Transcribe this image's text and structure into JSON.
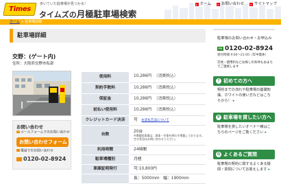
{
  "header": {
    "logo_text": "Times",
    "tagline": "歩いていた駐車場が見つかる！",
    "title_prefix": "タイムズの",
    "title_main": "月極駐車場検索",
    "links": [
      {
        "label": "ホーム"
      },
      {
        "label": "お問い合わせ"
      },
      {
        "label": "サイトマップ"
      }
    ]
  },
  "breadcrumb": {
    "home": "ホーム",
    "separator": " > ",
    "current": "駐車場詳細"
  },
  "main": {
    "page_title": "駐車場詳細",
    "lot_name": "交野：(ゲート内)",
    "address": "住所：大阪府交野市私部"
  },
  "inquiry": {
    "title": "お問い合わせ",
    "mail_label": "メールフォームでのお問い合わせ",
    "button_label": "お問い合わせフォーム",
    "tel_label": "電話でのお問い合わせ",
    "tel": "0120-02-8924"
  },
  "spec": {
    "rows": [
      {
        "label": "使用料",
        "value": "10,286円",
        "sub": "（消費税込）"
      },
      {
        "label": "契約手数料",
        "value": "10,286円",
        "sub": "（消費税込）"
      },
      {
        "label": "保証金",
        "value": "10,286円",
        "sub": "（消費税込）"
      },
      {
        "label": "前払い使用料",
        "value": "10,286円",
        "sub": "（消費税込）"
      },
      {
        "label": "クレジットカード決済",
        "value": "可",
        "sub": "お支払方法について"
      },
      {
        "label": "台数",
        "value": "20台",
        "sub": "※掲載駐車場は、満車・空車を問わず掲載しております。空き状況はお問い合わせください。"
      },
      {
        "label": "利用時間",
        "value": "24時間",
        "sub": ""
      },
      {
        "label": "駐車場種別",
        "value": "月極",
        "sub": ""
      },
      {
        "label": "車庫証明発行",
        "value": "可:10,800円",
        "sub": ""
      },
      {
        "label": "",
        "value": "長：5000mm",
        "sub": "幅：1900mm"
      }
    ]
  },
  "sidebar": {
    "contact_title": "駐車場のお問い合わせ・お申込み",
    "free_dial": "FD",
    "phone": "0120-02-8924",
    "hours": "受付時間 9:00～21:00（年中無休）",
    "note": "交地・使用料などお探しの条件もおまちでご連絡します",
    "sections": [
      {
        "icon": "?",
        "title": "初めての方へ",
        "body": "契約までの流れや駐車場の基礎知識、ホワイトの使い方などはこちらから！"
      },
      {
        "icon": "P",
        "title": "駐車場を貸したい方へ",
        "body": "駐車場を貸したいオーナー様はこちらのページをご覧ください"
      },
      {
        "icon": "Q",
        "title": "よくあるご質問",
        "body": "駐車場の契約に関するよくある疑問・質問についてお答えします"
      }
    ]
  },
  "colors": {
    "brand_yellow": "#ffd400",
    "crumb_orange": "#fbb300",
    "cta_orange": "#f08c00",
    "sidebar_green": "#2f8d46",
    "table_header": "#dfe3ea"
  }
}
